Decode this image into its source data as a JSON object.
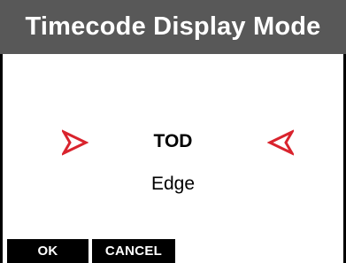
{
  "header": {
    "title": "Timecode Display Mode"
  },
  "selector": {
    "options": [
      "TOD",
      "Edge"
    ],
    "selected_index": 0,
    "left_arrow_icon": "chevron-right-outline-icon",
    "right_arrow_icon": "chevron-left-outline-icon",
    "arrow_color": "#d9232d"
  },
  "softkeys": {
    "ok_label": "OK",
    "cancel_label": "CANCEL"
  },
  "colors": {
    "title_bar": "#585858",
    "background": "#ffffff",
    "softkey_bg": "#000000",
    "softkey_text": "#ffffff"
  }
}
